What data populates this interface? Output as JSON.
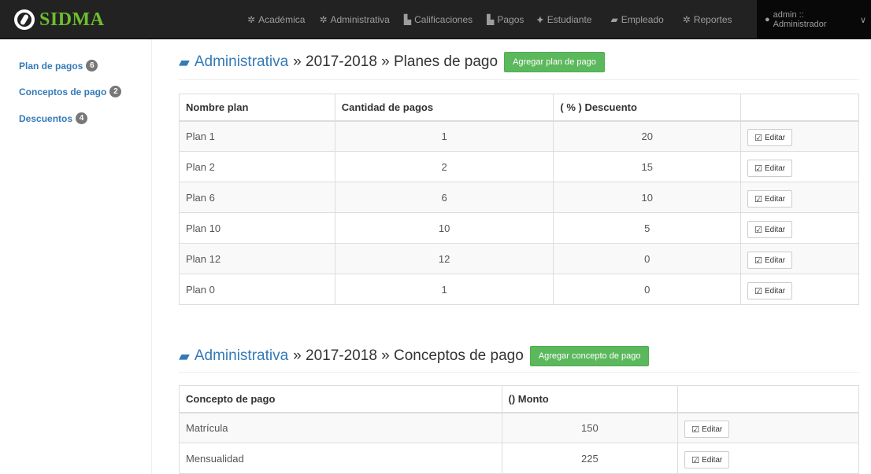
{
  "navbar": {
    "brand": "SIDMA",
    "items": [
      {
        "label": "Académica",
        "icon": "gear-icon"
      },
      {
        "label": "Administrativa",
        "icon": "gear-icon"
      },
      {
        "label": "Calificaciones",
        "icon": "file-icon"
      },
      {
        "label": "Pagos",
        "icon": "file-icon"
      },
      {
        "label": "Estudiante",
        "icon": "graduation-cap-icon"
      },
      {
        "label": "Empleado",
        "icon": "folder-open-icon"
      },
      {
        "label": "Reportes",
        "icon": "gear-icon"
      }
    ],
    "user": "admin :: Administrador"
  },
  "sidebar": {
    "items": [
      {
        "label": "Plan de pagos",
        "badge": "6"
      },
      {
        "label": "Conceptos de pago",
        "badge": "2"
      },
      {
        "label": "Descuentos",
        "badge": "4"
      }
    ]
  },
  "planes": {
    "header_link": "Administrativa",
    "header_rest": "» 2017-2018 » Planes de pago",
    "add_button": "Agregar plan de pago",
    "columns": [
      "Nombre plan",
      "Cantidad de pagos",
      "( % ) Descuento",
      ""
    ],
    "rows": [
      {
        "name": "Plan 1",
        "count": "1",
        "discount": "20"
      },
      {
        "name": "Plan 2",
        "count": "2",
        "discount": "15"
      },
      {
        "name": "Plan 6",
        "count": "6",
        "discount": "10"
      },
      {
        "name": "Plan 10",
        "count": "10",
        "discount": "5"
      },
      {
        "name": "Plan 12",
        "count": "12",
        "discount": "0"
      },
      {
        "name": "Plan 0",
        "count": "1",
        "discount": "0"
      }
    ],
    "edit_label": "Editar"
  },
  "conceptos": {
    "header_link": "Administrativa",
    "header_rest": "» 2017-2018 » Conceptos de pago",
    "add_button": "Agregar concepto de pago",
    "columns": [
      "Concepto de pago",
      "() Monto",
      ""
    ],
    "rows": [
      {
        "name": "Matrícula",
        "amount": "150"
      },
      {
        "name": "Mensualidad",
        "amount": "225"
      }
    ],
    "edit_label": "Editar"
  }
}
